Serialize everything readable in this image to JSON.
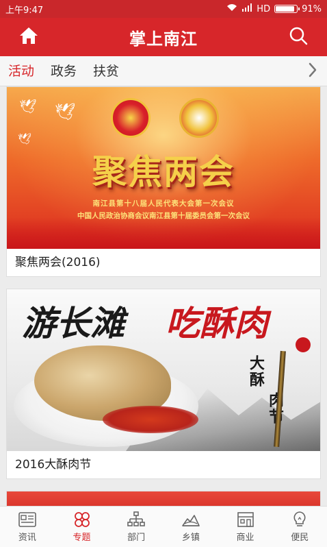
{
  "status_bar": {
    "time": "上午9:47",
    "network": "HD",
    "battery": "91%",
    "battery_level": 0.91
  },
  "app_bar": {
    "title": "掌上南江",
    "left_icon": "home-icon",
    "right_icon": "search-icon"
  },
  "tabs": [
    {
      "label": "活动",
      "active": true
    },
    {
      "label": "政务",
      "active": false
    },
    {
      "label": "扶贫",
      "active": false
    }
  ],
  "tabs_more_icon": "chevron-right-icon",
  "feed": [
    {
      "caption": "聚焦两会(2016)",
      "banner_title": "聚焦两会",
      "banner_line1": "南江县第十八届人民代表大会第一次会议",
      "banner_line2": "中国人民政治协商会议南江县第十届委员会第一次会议"
    },
    {
      "caption": "2016大酥肉节",
      "banner_calli_left": "游长滩",
      "banner_calli_right": "吃酥肉",
      "banner_vertical_1": "大酥",
      "banner_vertical_2": "肉节"
    }
  ],
  "bottom_nav": [
    {
      "label": "资讯",
      "icon": "news-icon",
      "active": false
    },
    {
      "label": "专题",
      "icon": "topics-icon",
      "active": true
    },
    {
      "label": "部门",
      "icon": "org-chart-icon",
      "active": false
    },
    {
      "label": "乡镇",
      "icon": "town-icon",
      "active": false
    },
    {
      "label": "商业",
      "icon": "shop-icon",
      "active": false
    },
    {
      "label": "便民",
      "icon": "lightbulb-icon",
      "active": false
    }
  ],
  "colors": {
    "brand_red": "#d7262a",
    "active_tab": "#d7262a"
  }
}
